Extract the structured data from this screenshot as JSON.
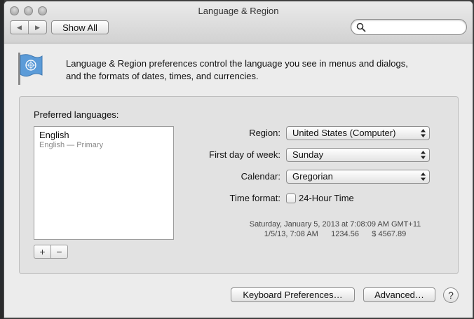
{
  "window": {
    "title": "Language & Region"
  },
  "toolbar": {
    "back_label": "◀",
    "forward_label": "▶",
    "show_all_label": "Show All",
    "search": {
      "placeholder": "",
      "value": ""
    }
  },
  "description": {
    "line1": "Language & Region preferences control the language you see in menus and dialogs,",
    "line2": "and the formats of dates, times, and currencies."
  },
  "languages": {
    "label": "Preferred languages:",
    "items": [
      {
        "name": "English",
        "sub": "English — Primary"
      }
    ],
    "add_label": "+",
    "remove_label": "−"
  },
  "settings": {
    "region": {
      "label": "Region:",
      "value": "United States (Computer)"
    },
    "first_day": {
      "label": "First day of week:",
      "value": "Sunday"
    },
    "calendar": {
      "label": "Calendar:",
      "value": "Gregorian"
    },
    "time_format": {
      "label": "Time format:",
      "checkbox_label": "24-Hour Time",
      "checked": false
    }
  },
  "sample": {
    "line1": "Saturday, January 5, 2013 at 7:08:09 AM GMT+11",
    "line2": "1/5/13, 7:08 AM      1234.56      $ 4567.89"
  },
  "footer": {
    "keyboard_label": "Keyboard Preferences…",
    "advanced_label": "Advanced…",
    "help_label": "?"
  },
  "icons": {
    "window_buttons": [
      "close-icon",
      "minimize-icon",
      "zoom-icon"
    ],
    "search": "search-icon",
    "flag": "un-flag-icon"
  }
}
